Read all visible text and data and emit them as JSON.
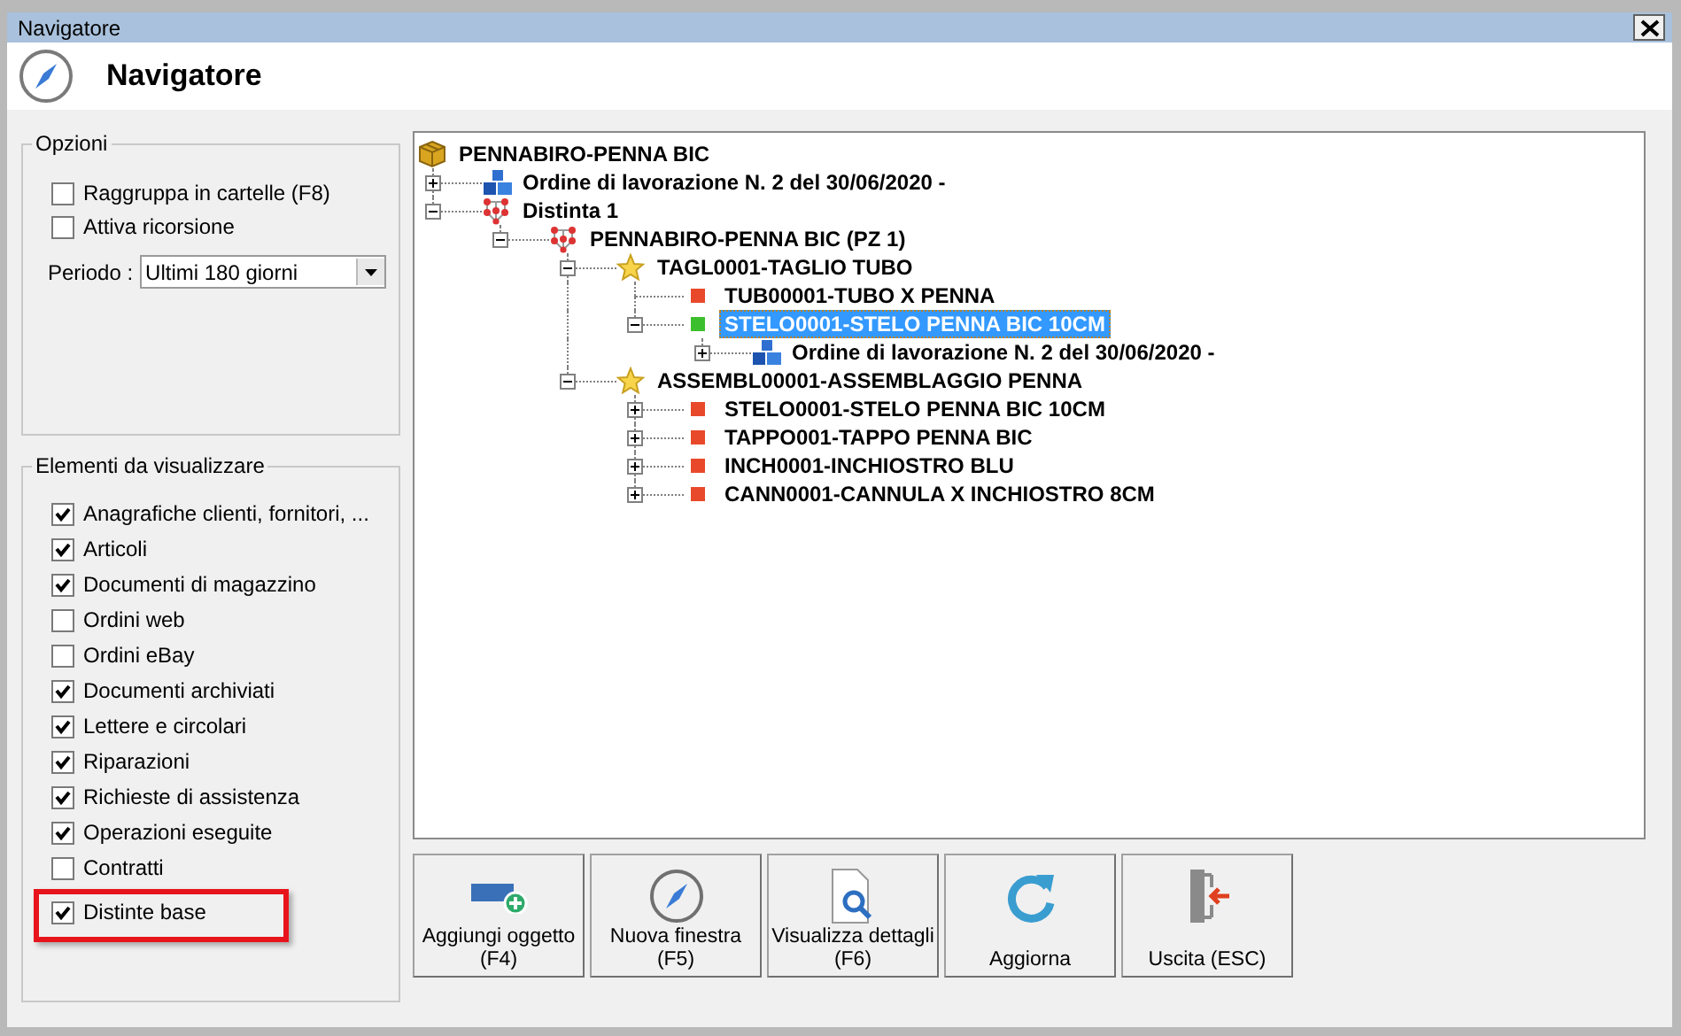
{
  "window": {
    "title": "Navigatore"
  },
  "header": {
    "title": "Navigatore"
  },
  "options": {
    "legend": "Opzioni",
    "checkboxes": [
      {
        "label": "Raggruppa in cartelle (F8)",
        "checked": false
      },
      {
        "label": "Attiva ricorsione",
        "checked": false
      }
    ],
    "period": {
      "label": "Periodo :",
      "value": "Ultimi 180 giorni"
    }
  },
  "elements": {
    "legend": "Elementi da visualizzare",
    "items": [
      {
        "label": "Anagrafiche clienti, fornitori, ...",
        "checked": true,
        "highlighted": false
      },
      {
        "label": "Articoli",
        "checked": true,
        "highlighted": false
      },
      {
        "label": "Documenti di magazzino",
        "checked": true,
        "highlighted": false
      },
      {
        "label": "Ordini web",
        "checked": false,
        "highlighted": false
      },
      {
        "label": "Ordini eBay",
        "checked": false,
        "highlighted": false
      },
      {
        "label": "Documenti archiviati",
        "checked": true,
        "highlighted": false
      },
      {
        "label": "Lettere e circolari",
        "checked": true,
        "highlighted": false
      },
      {
        "label": "Riparazioni",
        "checked": true,
        "highlighted": false
      },
      {
        "label": "Richieste di assistenza",
        "checked": true,
        "highlighted": false
      },
      {
        "label": "Operazioni eseguite",
        "checked": true,
        "highlighted": false
      },
      {
        "label": "Contratti",
        "checked": false,
        "highlighted": false
      },
      {
        "label": "Distinte base",
        "checked": true,
        "highlighted": true
      }
    ]
  },
  "tree": [
    {
      "label": "PENNABIRO-PENNA BIC",
      "kind": "package",
      "selected": false,
      "children": [
        {
          "label": "Ordine di lavorazione N. 2 del 30/06/2020 -",
          "kind": "order",
          "selected": false,
          "expanded": false
        },
        {
          "label": "Distinta 1",
          "kind": "bom",
          "selected": false,
          "expanded": true,
          "children": [
            {
              "label": "PENNABIRO-PENNA BIC (PZ 1)",
              "kind": "bom",
              "selected": false,
              "expanded": true,
              "children": [
                {
                  "label": "TAGL0001-TAGLIO TUBO",
                  "kind": "star",
                  "selected": false,
                  "expanded": true,
                  "children": [
                    {
                      "label": "TUB00001-TUBO X PENNA",
                      "kind": "square",
                      "color": "#e8492b",
                      "selected": false
                    },
                    {
                      "label": "STELO0001-STELO PENNA BIC 10CM",
                      "kind": "square",
                      "color": "#3cbf2c",
                      "selected": true,
                      "expanded": true,
                      "children": [
                        {
                          "label": "Ordine di lavorazione N. 2 del 30/06/2020 -",
                          "kind": "order",
                          "selected": false,
                          "expanded": false
                        }
                      ]
                    }
                  ]
                },
                {
                  "label": "ASSEMBL00001-ASSEMBLAGGIO PENNA",
                  "kind": "star",
                  "selected": false,
                  "expanded": true,
                  "children": [
                    {
                      "label": "STELO0001-STELO PENNA BIC 10CM",
                      "kind": "square",
                      "color": "#e8492b",
                      "selected": false,
                      "expanded": false
                    },
                    {
                      "label": "TAPPO001-TAPPO PENNA BIC",
                      "kind": "square",
                      "color": "#e8492b",
                      "selected": false,
                      "expanded": false
                    },
                    {
                      "label": "INCH0001-INCHIOSTRO BLU",
                      "kind": "square",
                      "color": "#e8492b",
                      "selected": false,
                      "expanded": false
                    },
                    {
                      "label": "CANN0001-CANNULA X INCHIOSTRO 8CM",
                      "kind": "square",
                      "color": "#e8492b",
                      "selected": false,
                      "expanded": false
                    }
                  ]
                }
              ]
            }
          ]
        }
      ]
    }
  ],
  "buttons": [
    {
      "kind": "add",
      "lines": [
        "Aggiungi oggetto",
        "(F4)"
      ]
    },
    {
      "kind": "compass",
      "lines": [
        "Nuova finestra",
        "(F5)"
      ]
    },
    {
      "kind": "details",
      "lines": [
        "Visualizza dettagli",
        "(F6)"
      ]
    },
    {
      "kind": "refresh",
      "lines": [
        "Aggiorna"
      ]
    },
    {
      "kind": "exit",
      "lines": [
        "Uscita (ESC)"
      ]
    }
  ]
}
